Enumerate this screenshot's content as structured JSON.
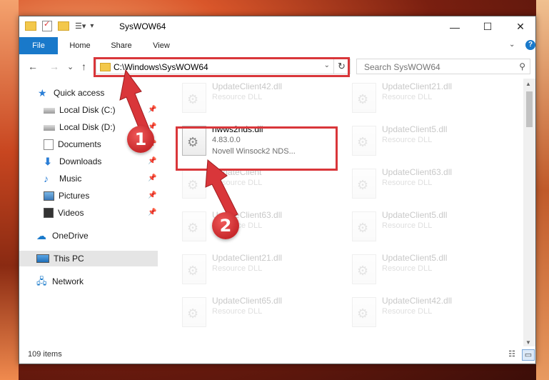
{
  "window": {
    "title": "SysWOW64",
    "controls": {
      "minimize": "—",
      "maximize": "☐",
      "close": "✕"
    }
  },
  "ribbon": {
    "tabs": [
      "File",
      "Home",
      "Share",
      "View"
    ],
    "help": "?"
  },
  "nav": {
    "back": "←",
    "forward": "→",
    "recent": "⌄",
    "up": "↑",
    "address": "C:\\Windows\\SysWOW64",
    "search_placeholder": "Search SysWOW64"
  },
  "sidebar": {
    "items": [
      {
        "label": "Quick access",
        "icon": "star-icon"
      },
      {
        "label": "Local Disk (C:)",
        "icon": "drive-icon"
      },
      {
        "label": "Local Disk (D:)",
        "icon": "drive-icon"
      },
      {
        "label": "Documents",
        "icon": "documents-icon"
      },
      {
        "label": "Downloads",
        "icon": "downloads-icon"
      },
      {
        "label": "Music",
        "icon": "music-icon"
      },
      {
        "label": "Pictures",
        "icon": "pictures-icon"
      },
      {
        "label": "Videos",
        "icon": "videos-icon"
      },
      {
        "label": "OneDrive",
        "icon": "cloud-icon"
      },
      {
        "label": "This PC",
        "icon": "pc-icon"
      },
      {
        "label": "Network",
        "icon": "network-icon"
      }
    ]
  },
  "files": {
    "left": [
      {
        "name": "UpdateClient42.dll",
        "type": "Resource DLL"
      },
      {
        "name": "nwws2nds.dll",
        "version": "4.83.0.0",
        "desc": "Novell Winsock2 NDS..."
      },
      {
        "name": "UpdateClient",
        "type": "Resource DLL"
      },
      {
        "name": "UpdateClient63.dll",
        "type": "Resource DLL"
      },
      {
        "name": "UpdateClient21.dll",
        "type": "Resource DLL"
      },
      {
        "name": "UpdateClient65.dll",
        "type": "Resource DLL"
      }
    ],
    "right": [
      {
        "name": "UpdateClient21.dll",
        "type": "Resource DLL"
      },
      {
        "name": "UpdateClient5.dll",
        "type": "Resource DLL"
      },
      {
        "name": "UpdateClient63.dll",
        "type": "Resource DLL"
      },
      {
        "name": "UpdateClient5.dll",
        "type": "Resource DLL"
      },
      {
        "name": "UpdateClient5.dll",
        "type": "Resource DLL"
      },
      {
        "name": "UpdateClient42.dll",
        "type": "Resource DLL"
      }
    ]
  },
  "status": {
    "count": "109 items"
  },
  "callouts": {
    "one": "1",
    "two": "2"
  },
  "colors": {
    "accent": "#1979ca",
    "highlight": "#d9363a"
  }
}
